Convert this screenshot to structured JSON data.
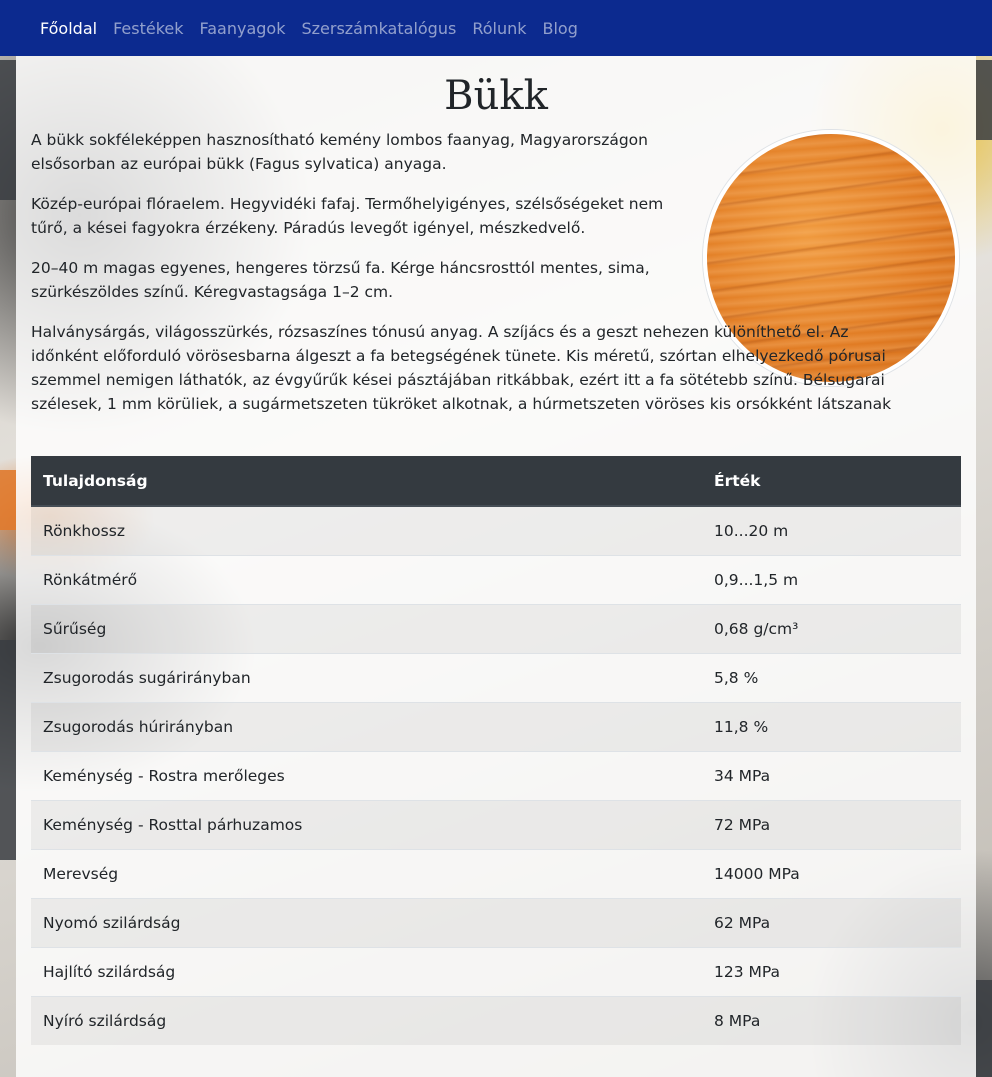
{
  "nav": {
    "items": [
      {
        "label": "Főoldal",
        "active": true
      },
      {
        "label": "Festékek",
        "active": false
      },
      {
        "label": "Faanyagok",
        "active": false
      },
      {
        "label": "Szerszámkatalógus",
        "active": false
      },
      {
        "label": "Rólunk",
        "active": false
      },
      {
        "label": "Blog",
        "active": false
      }
    ]
  },
  "page": {
    "title": "Bükk",
    "paragraphs": [
      "A bükk sokféleképpen hasznosítható kemény lombos faanyag, Magyarországon elsősorban az európai bükk (Fagus sylvatica) anyaga.",
      "Közép-európai flóraelem. Hegyvidéki fafaj. Termőhelyigényes, szélsőségeket nem tűrő, a kései fagyokra érzékeny. Páradús levegőt igényel, mészkedvelő.",
      "20–40 m magas egyenes, hengeres törzsű fa. Kérge háncsrosttól mentes, sima, szürkészöldes színű. Kéregvastagsága 1–2 cm.",
      "Halványsárgás, világosszürkés, rózsaszínes tónusú anyag. A szíjács és a geszt nehezen különíthető el. Az időnként előforduló vörösesbarna álgeszt a fa betegségének tünete. Kis méretű, szórtan elhelyezkedő pórusai szemmel nemigen láthatók, az évgyűrűk kései pásztájában ritkábbak, ezért itt a fa sötétebb színű. Bélsugarai szélesek, 1 mm körüliek, a sugármetszeten tükröket alkotnak, a húrmetszeten vöröses kis orsókként látszanak"
    ]
  },
  "table": {
    "headers": {
      "property": "Tulajdonság",
      "value": "Érték"
    },
    "rows": [
      {
        "property": "Rönkhossz",
        "value": "10...20 m"
      },
      {
        "property": "Rönkátmérő",
        "value": "0,9...1,5 m"
      },
      {
        "property": "Sűrűség",
        "value": "0,68 g/cm³"
      },
      {
        "property": "Zsugorodás sugárirányban",
        "value": "5,8 %"
      },
      {
        "property": "Zsugorodás húrirányban",
        "value": "11,8 %"
      },
      {
        "property": "Keménység - Rostra merőleges",
        "value": "34 MPa"
      },
      {
        "property": "Keménység - Rosttal párhuzamos",
        "value": "72 MPa"
      },
      {
        "property": "Merevség",
        "value": "14000 MPa"
      },
      {
        "property": "Nyomó szilárdság",
        "value": "62 MPa"
      },
      {
        "property": "Hajlító szilárdság",
        "value": "123 MPa"
      },
      {
        "property": "Nyíró szilárdság",
        "value": "8 MPa"
      }
    ]
  },
  "colors": {
    "navbar": "#0c2a8f",
    "table_header": "#343a40"
  }
}
